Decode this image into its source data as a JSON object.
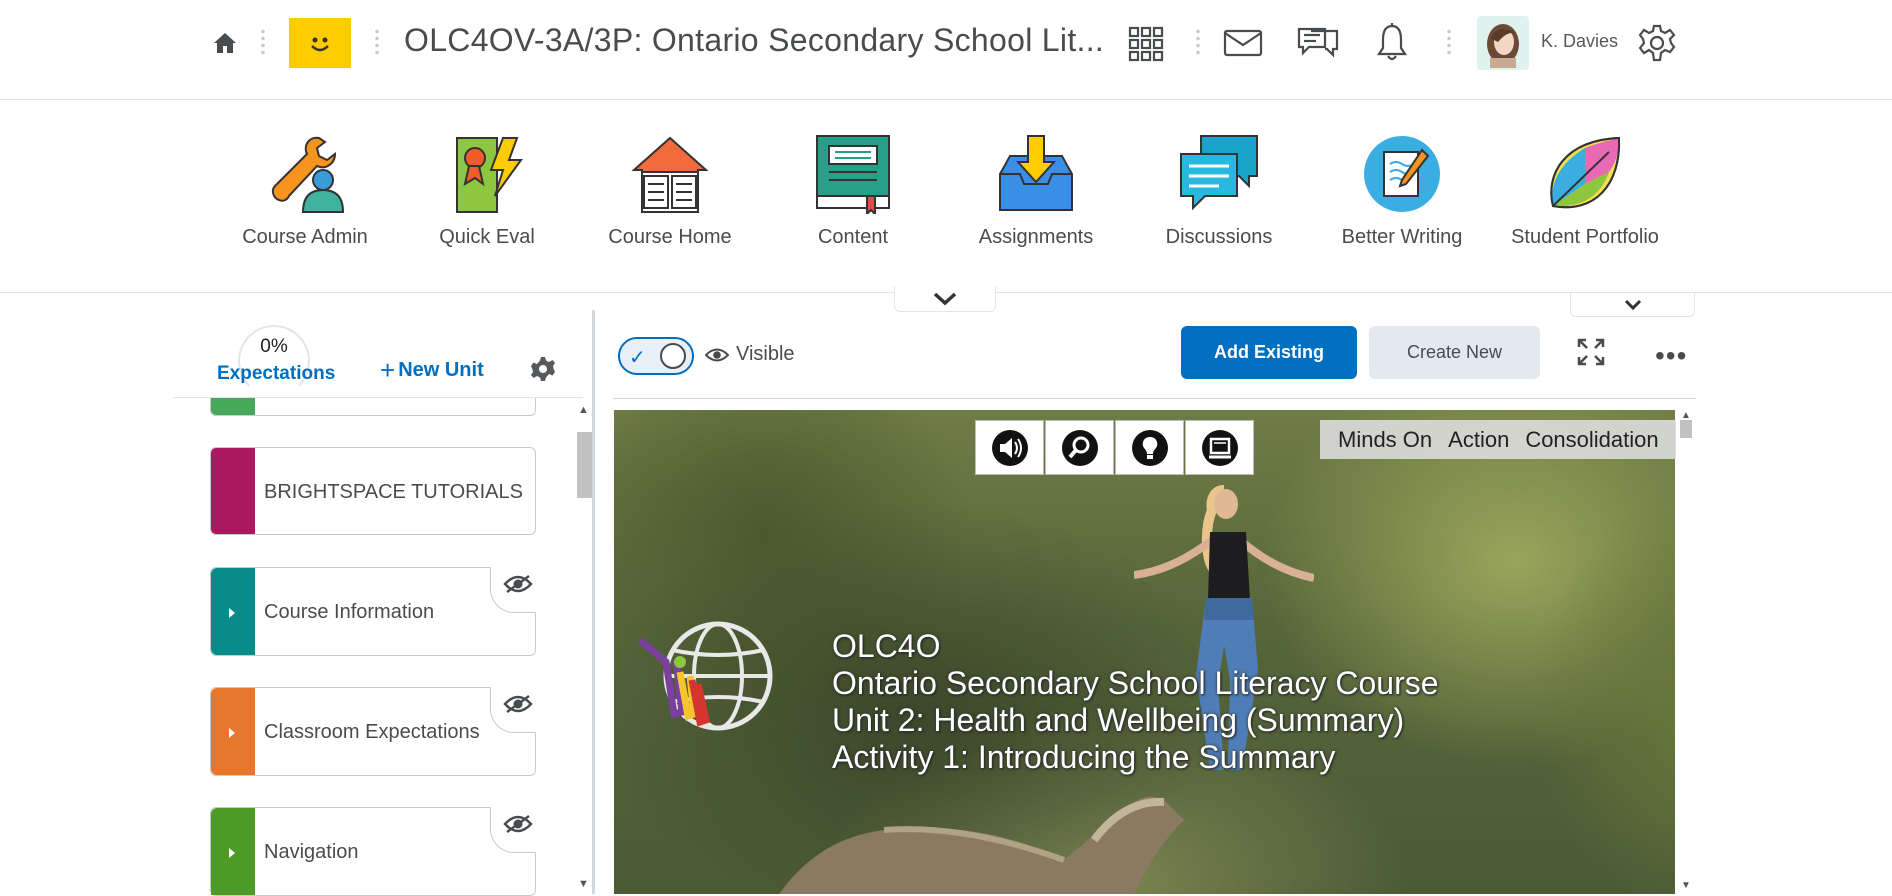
{
  "topbar": {
    "course_title": "OLC4OV-3A/3P: Ontario Secondary School Lit...",
    "username": "K. Davies"
  },
  "navbar": {
    "items": [
      {
        "label": "Course Admin",
        "icon": "wrench-person-icon"
      },
      {
        "label": "Quick Eval",
        "icon": "ribbon-lightning-icon"
      },
      {
        "label": "Course Home",
        "icon": "house-book-icon"
      },
      {
        "label": "Content",
        "icon": "book-icon"
      },
      {
        "label": "Assignments",
        "icon": "inbox-arrow-icon"
      },
      {
        "label": "Discussions",
        "icon": "chat-bubbles-icon"
      },
      {
        "label": "Better Writing",
        "icon": "notepad-pen-icon"
      },
      {
        "label": "Student Portfolio",
        "icon": "leaf-icon"
      }
    ]
  },
  "left_panel": {
    "progress_percent": "0%",
    "expectations_label": "Expectations",
    "new_unit_label": "New Unit",
    "units": [
      {
        "title": "BRIGHTSPACE TUTORIALS",
        "color": "#a8195f"
      },
      {
        "title": "Course Information",
        "color": "#0b8a8a"
      },
      {
        "title": "Classroom Expectations",
        "color": "#e8772e"
      },
      {
        "title": "Navigation",
        "color": "#4e9a26"
      }
    ],
    "partial_unit_color": "#45a85a"
  },
  "toolbar": {
    "visible_label": "Visible",
    "add_existing_label": "Add Existing",
    "create_new_label": "Create New"
  },
  "lesson": {
    "line1": "OLC4O",
    "line2": "Ontario Secondary School Literacy Course",
    "line3": "Unit 2: Health and Wellbeing (Summary)",
    "line4": "Activity 1: Introducing the Summary",
    "phases": [
      "Minds On",
      "Action",
      "Consolidation"
    ]
  },
  "colors": {
    "accent": "#006fbf",
    "logo_bg": "#ffcc00"
  }
}
